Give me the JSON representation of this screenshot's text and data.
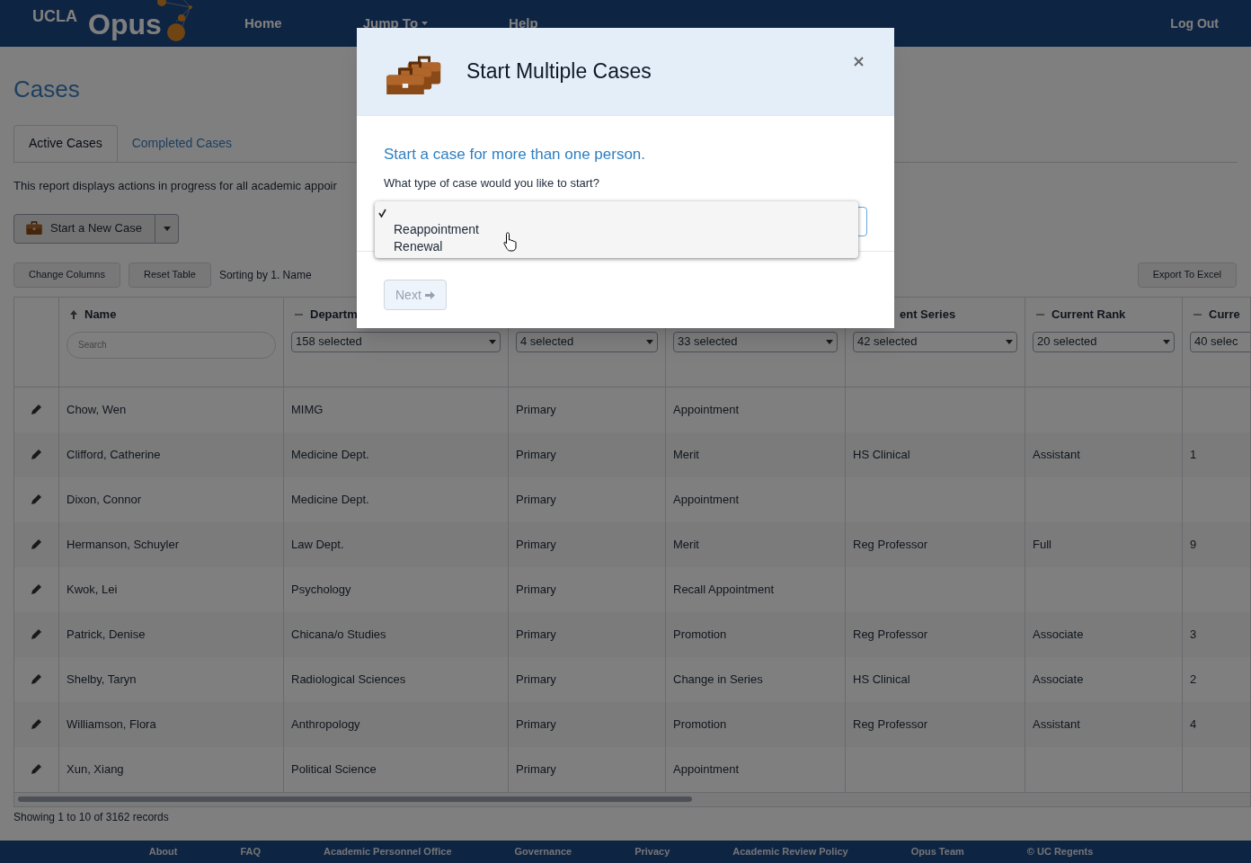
{
  "header": {
    "logo_small": "UCLA",
    "logo": "Opus",
    "nav": [
      {
        "label": "Home",
        "kind": "link"
      },
      {
        "label": "Jump To",
        "kind": "menu"
      },
      {
        "label": "Help",
        "kind": "link"
      }
    ],
    "logout": "Log Out"
  },
  "page": {
    "title": "Cases",
    "tabs": [
      {
        "label": "Active Cases",
        "selected": true
      },
      {
        "label": "Completed Cases",
        "selected": false
      }
    ],
    "description": "This report displays actions in progress for all academic appoir",
    "start_button": "Start a New Case",
    "change_columns": "Change Columns",
    "reset_table": "Reset Table",
    "sorting": "Sorting by 1. Name",
    "export": "Export To Excel"
  },
  "table": {
    "columns": [
      {
        "label": "Name",
        "sorted": true,
        "filter_placeholder": "Search"
      },
      {
        "label": "Departm",
        "sorted": false,
        "filter": "158 selected"
      },
      {
        "filter": "4 selected"
      },
      {
        "filter": "33 selected"
      },
      {
        "label": "ent Series",
        "filter": "42 selected"
      },
      {
        "label": "Current Rank",
        "sorted": false,
        "filter": "20 selected"
      },
      {
        "label": "Curre",
        "sorted": false,
        "filter": "40 selec"
      }
    ],
    "rows": [
      [
        "Chow, Wen",
        "MIMG",
        "Primary",
        "Appointment",
        "",
        "",
        ""
      ],
      [
        "Clifford, Catherine",
        "Medicine Dept.",
        "Primary",
        "Merit",
        "HS Clinical",
        "Assistant",
        "1"
      ],
      [
        "Dixon, Connor",
        "Medicine Dept.",
        "Primary",
        "Appointment",
        "",
        "",
        ""
      ],
      [
        "Hermanson, Schuyler",
        "Law Dept.",
        "Primary",
        "Merit",
        "Reg Professor",
        "Full",
        "9"
      ],
      [
        "Kwok, Lei",
        "Psychology",
        "Primary",
        "Recall Appointment",
        "",
        "",
        ""
      ],
      [
        "Patrick, Denise",
        "Chicana/o Studies",
        "Primary",
        "Promotion",
        "Reg Professor",
        "Associate",
        "3"
      ],
      [
        "Shelby, Taryn",
        "Radiological Sciences",
        "Primary",
        "Change in Series",
        "HS Clinical",
        "Associate",
        "2"
      ],
      [
        "Williamson, Flora",
        "Anthropology",
        "Primary",
        "Promotion",
        "Reg Professor",
        "Assistant",
        "4"
      ],
      [
        "Xun, Xiang",
        "Political Science",
        "Primary",
        "Appointment",
        "",
        "",
        ""
      ]
    ],
    "status": "Showing 1 to 10 of 3162 records"
  },
  "footer": [
    "About",
    "FAQ",
    "Academic Personnel Office",
    "Governance",
    "Privacy",
    "Academic Review Policy",
    "Opus Team",
    "© UC Regents"
  ],
  "modal": {
    "title": "Start Multiple Cases",
    "heading": "Start a case for more than one person.",
    "question": "What type of case would you like to start?",
    "options": [
      {
        "selected": true
      },
      {
        "label": "Reappointment",
        "selected": false
      },
      {
        "label": "Renewal",
        "selected": false
      }
    ],
    "next": "Next",
    "next_disabled": true
  }
}
